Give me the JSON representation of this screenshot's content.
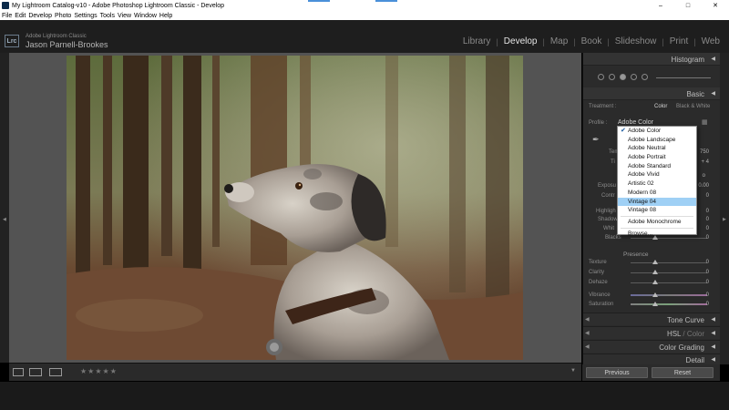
{
  "window": {
    "title": "My Lightroom Catalog-v10 - Adobe Photoshop Lightroom Classic - Develop",
    "minimize": "–",
    "maximize": "□",
    "close": "✕"
  },
  "menu": [
    "File",
    "Edit",
    "Develop",
    "Photo",
    "Settings",
    "Tools",
    "View",
    "Window",
    "Help"
  ],
  "identity": {
    "badge": "Lrc",
    "app": "Adobe Lightroom Classic",
    "user": "Jason Parnell-Brookes"
  },
  "modules": [
    "Library",
    "Develop",
    "Map",
    "Book",
    "Slideshow",
    "Print",
    "Web"
  ],
  "active_module": "Develop",
  "panels": {
    "histogram": "Histogram",
    "basic": "Basic",
    "tone_curve": "Tone Curve",
    "hsl": "HSL",
    "hsl_sep": " / ",
    "color": "Color",
    "color_grading": "Color Grading",
    "detail": "Detail"
  },
  "basic": {
    "treatment_label": "Treatment :",
    "treatment_color": "Color",
    "treatment_bw": "Black & White",
    "profile_label": "Profile :",
    "profile_value": "Adobe Color",
    "temp_label": "Tem",
    "temp_value": "750",
    "tint_label": "Ti",
    "tint_value": "+ 4",
    "auto": "o",
    "exposure_label": "Exposu",
    "exposure_value": "0.00",
    "contrast_label": "Contr",
    "contrast_value": "0",
    "highlights_label": "Highligh",
    "highlights_value": "0",
    "shadows_label": "Shadow",
    "shadows_value": "0",
    "whites_label": "Whit",
    "whites_value": "0",
    "blacks_label": "Blacks",
    "blacks_value": "0",
    "presence": "Presence",
    "texture_label": "Texture",
    "texture_value": "0",
    "clarity_label": "Clarity",
    "clarity_value": "0",
    "dehaze_label": "Dehaze",
    "dehaze_value": "0",
    "vibrance_label": "Vibrance",
    "vibrance_value": "0",
    "saturation_label": "Saturation",
    "saturation_value": "0"
  },
  "profile_menu": {
    "options": [
      "Adobe Color",
      "Adobe Landscape",
      "Adobe Neutral",
      "Adobe Portrait",
      "Adobe Standard",
      "Adobe Vivid",
      "Artistic 02",
      "Modern 08",
      "Vintage 04",
      "Vintage 08"
    ],
    "extra": [
      "Adobe Monochrome",
      "Browse..."
    ],
    "checked": "Adobe Color",
    "hovered": "Vintage 04"
  },
  "toolbar": {
    "stars": "★★★★★"
  },
  "buttons": {
    "previous": "Previous",
    "reset": "Reset"
  },
  "colors": {
    "panel_bg": "#2b2b2b",
    "work_bg": "#535353",
    "highlight": "#9fd0f5",
    "active_module": "#e6e6e6"
  }
}
